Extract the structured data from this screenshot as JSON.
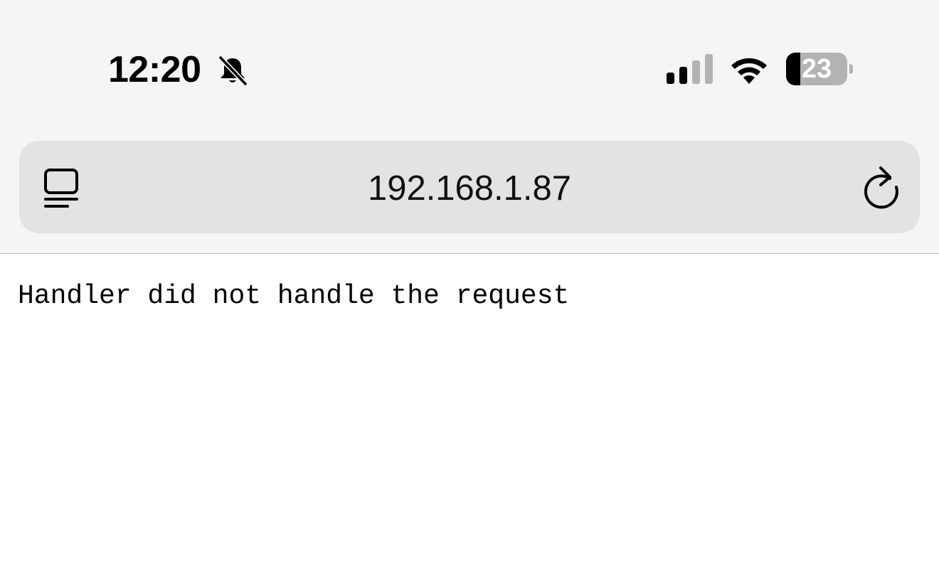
{
  "status_bar": {
    "time": "12:20",
    "battery_percent": "23",
    "battery_level": 0.23,
    "signal_bars_active": 2,
    "signal_bars_total": 4,
    "icons": [
      "bell-slash-icon",
      "cellular-signal-icon",
      "wifi-icon",
      "battery-icon"
    ]
  },
  "address_bar": {
    "url": "192.168.1.87",
    "icons": [
      "tab-overview-icon",
      "reload-icon"
    ]
  },
  "page": {
    "message": "Handler did not handle the request"
  },
  "colors": {
    "chrome_background": "#f5f5f5",
    "address_bar_background": "#e3e3e3",
    "battery_gray": "#b3b3b3",
    "text": "#000000"
  }
}
